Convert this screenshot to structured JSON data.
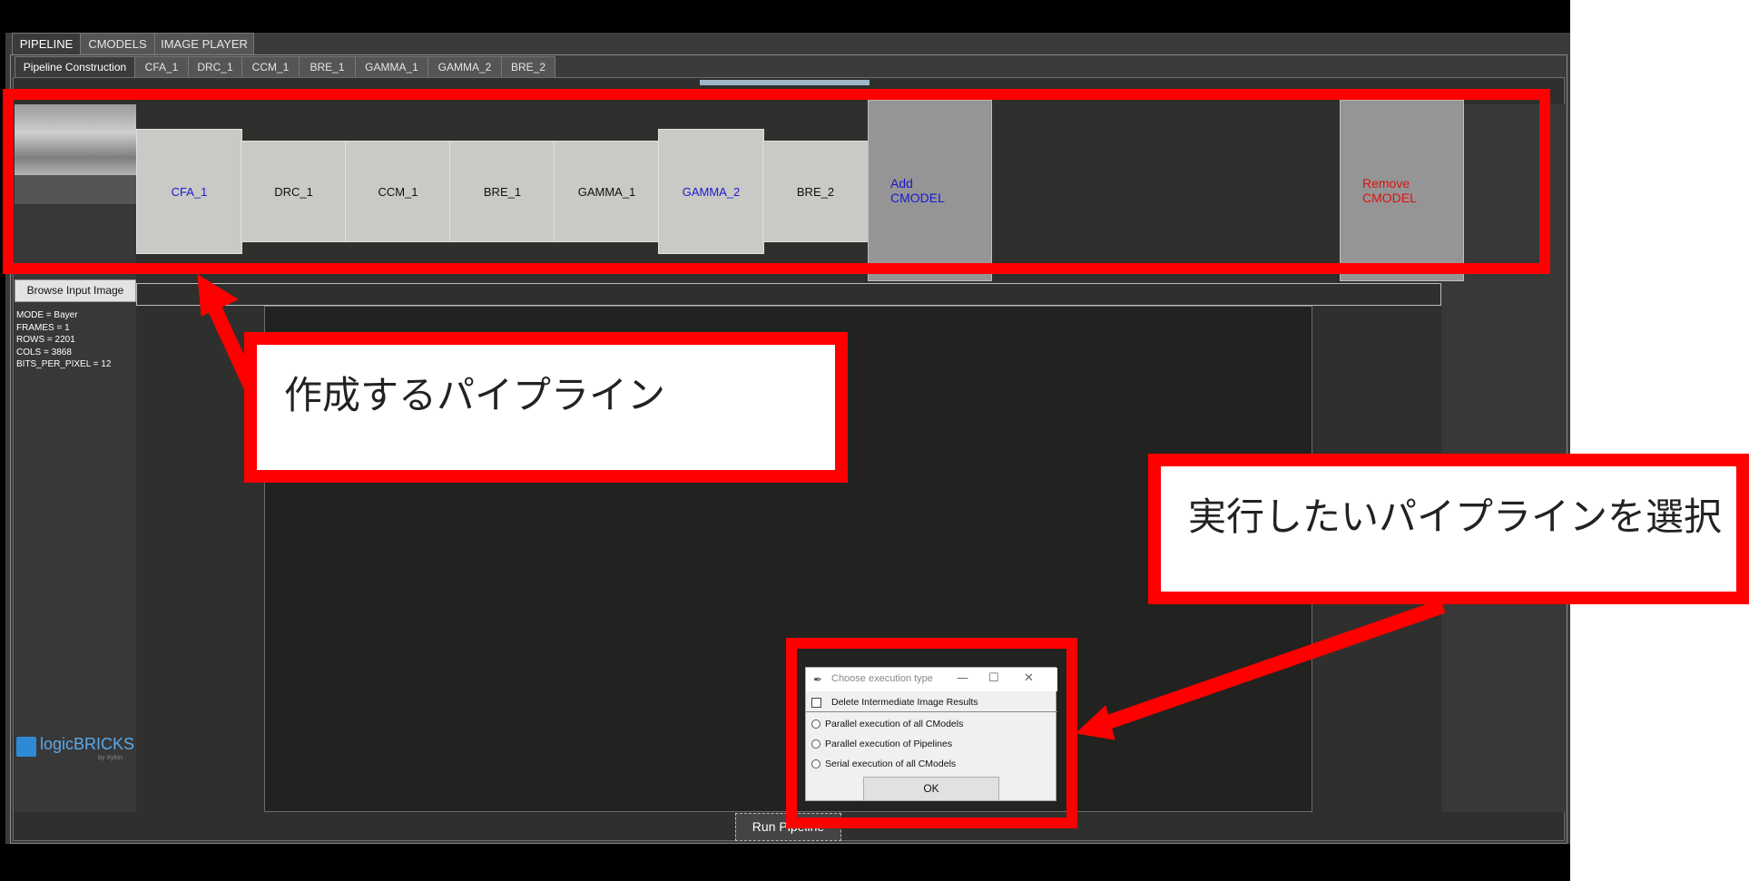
{
  "main_tabs": [
    {
      "label": "PIPELINE",
      "active": true
    },
    {
      "label": "CMODELS",
      "active": false
    },
    {
      "label": "IMAGE PLAYER",
      "active": false
    }
  ],
  "sub_tabs": [
    {
      "label": "Pipeline Construction",
      "active": true
    },
    {
      "label": "CFA_1"
    },
    {
      "label": "DRC_1"
    },
    {
      "label": "CCM_1"
    },
    {
      "label": "BRE_1"
    },
    {
      "label": "GAMMA_1"
    },
    {
      "label": "GAMMA_2"
    },
    {
      "label": "BRE_2"
    }
  ],
  "pipeline_blocks": [
    {
      "label": "CFA_1",
      "selected": true
    },
    {
      "label": "DRC_1",
      "selected": false
    },
    {
      "label": "CCM_1",
      "selected": false
    },
    {
      "label": "BRE_1",
      "selected": false
    },
    {
      "label": "GAMMA_1",
      "selected": false
    },
    {
      "label": "GAMMA_2",
      "selected": true
    },
    {
      "label": "BRE_2",
      "selected": false
    }
  ],
  "actions": {
    "add_cmodel": "Add\nCMODEL",
    "remove_cmodel": "Remove\nCMODEL"
  },
  "input": {
    "browse_label": "Browse Input Image",
    "path_value": ""
  },
  "image_info": [
    "MODE = Bayer",
    "FRAMES = 1",
    "ROWS = 2201",
    "COLS = 3868",
    "BITS_PER_PIXEL = 12"
  ],
  "logo": {
    "text": "logicBRICKS",
    "sub": "by Xylon"
  },
  "run_button": "Run Pipeline",
  "dialog": {
    "title": "Choose execution type",
    "delete_checkbox": "Delete Intermediate Image Results",
    "options": [
      "Parallel execution of all CModels",
      "Parallel execution of Pipelines",
      "Serial execution of all CModels"
    ],
    "ok": "OK"
  },
  "annotations": {
    "pipeline_callout": "作成するパイプライン",
    "select_callout": "実行したいパイプラインを選択"
  },
  "colors": {
    "annotation": "#ff0000",
    "selected_text": "#1a1ad0",
    "remove_text": "#e01010"
  }
}
